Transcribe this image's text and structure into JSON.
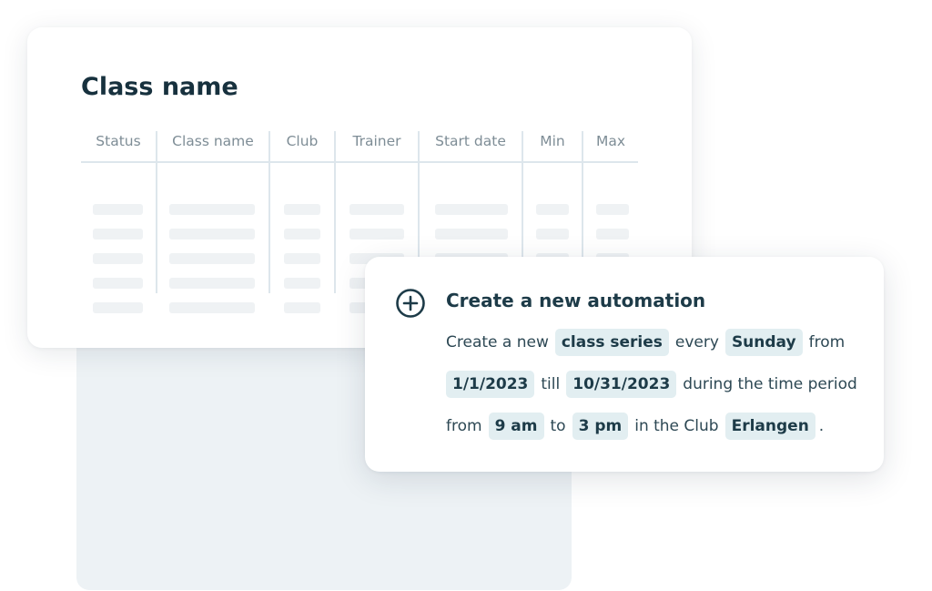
{
  "table_card": {
    "title": "Class name",
    "columns": [
      "Status",
      "Class name",
      "Club",
      "Trainer",
      "Start date",
      "Min",
      "Max"
    ]
  },
  "automation": {
    "icon": "plus-circle-icon",
    "title": "Create a new automation",
    "line1": {
      "t1": "Create a new",
      "chip1": "class series",
      "t2": "every",
      "chip2": "Sunday",
      "t3": "from"
    },
    "line2": {
      "chip1": "1/1/2023",
      "t1": "till",
      "chip2": "10/31/2023",
      "t2": "during the time period"
    },
    "line3": {
      "t1": "from",
      "chip1": "9 am",
      "t2": "to",
      "chip2": "3 pm",
      "t3": "in the Club",
      "chip3": "Erlangen",
      "t4": "."
    }
  },
  "colors": {
    "title_text": "#17313e",
    "accent_icon": "#1d3b48",
    "chip_background": "#e2eef1",
    "back_panel": "#edf2f5"
  }
}
